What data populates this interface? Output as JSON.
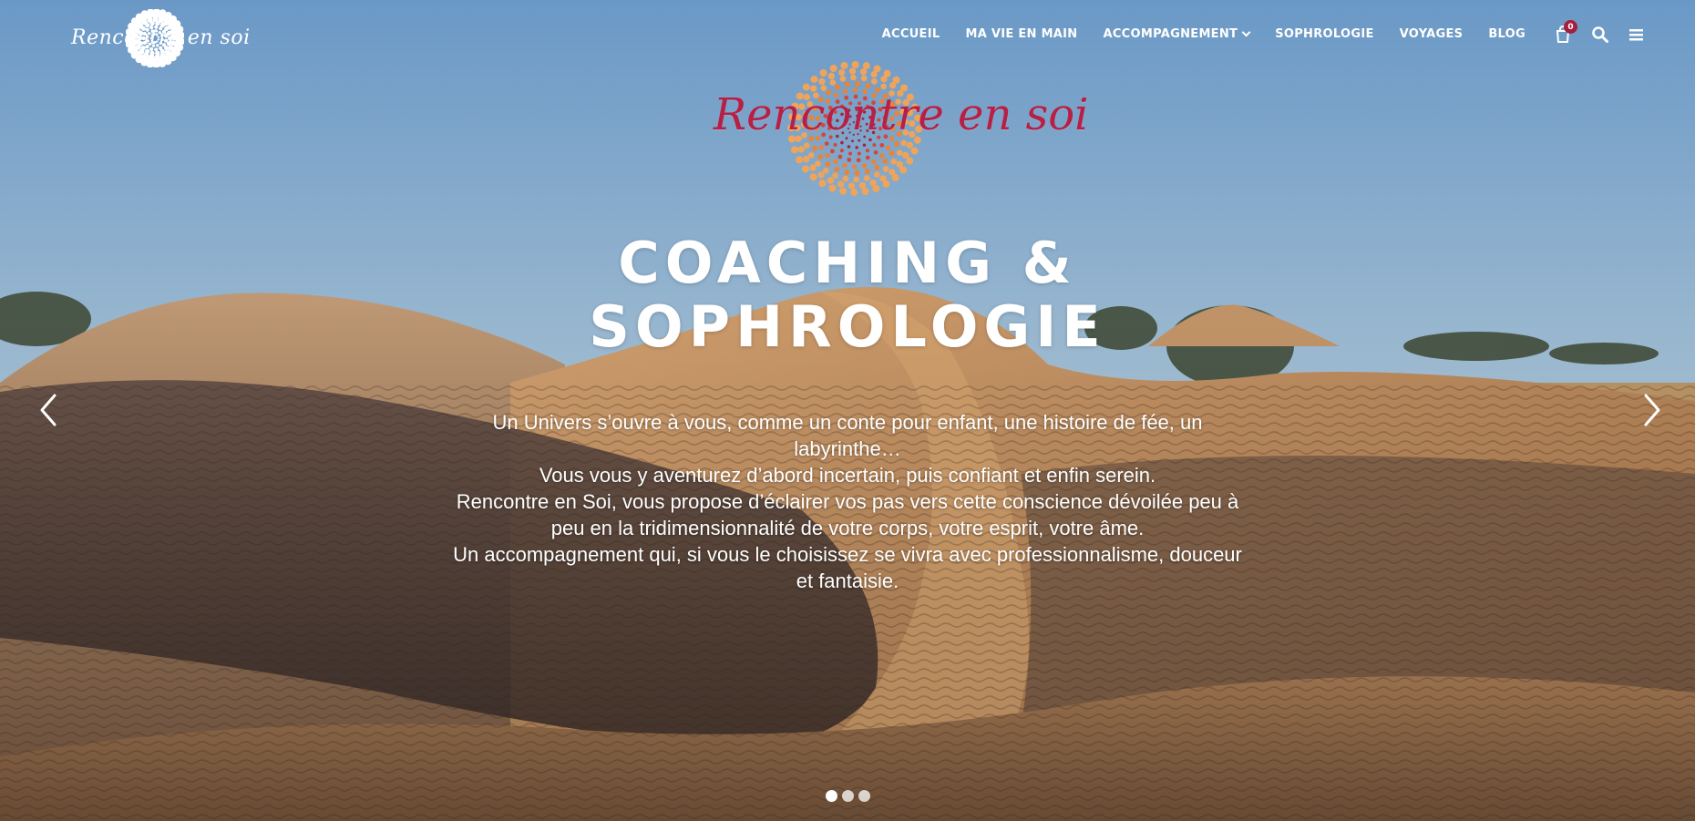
{
  "header": {
    "logo_text": "Rencontre en soi",
    "nav": [
      {
        "label": "ACCUEIL"
      },
      {
        "label": "MA VIE EN MAIN"
      },
      {
        "label": "ACCOMPAGNEMENT"
      },
      {
        "label": "SOPHROLOGIE"
      },
      {
        "label": "VOYAGES"
      },
      {
        "label": "BLOG"
      }
    ],
    "cart_count": "0",
    "icons": [
      "cart-icon",
      "search-icon",
      "menu-icon"
    ]
  },
  "hero": {
    "brand_text": "Rencontre en soi",
    "title_line1": "COACHING &",
    "title_line2": "SOPHROLOGIE",
    "paragraphs": [
      "Un Univers s’ouvre à vous, comme un conte pour enfant, une histoire de fée, un labyrinthe…",
      "Vous vous y aventurez d’abord incertain, puis confiant et enfin serein.",
      "Rencontre en Soi, vous propose d’éclairer vos pas vers cette conscience dévoilée peu à peu en la tridimensionnalité de votre corps, votre esprit, votre âme.",
      "Un accompagnement qui, si vous le choisissez se vivra avec professionnalisme, douceur et fantaisie."
    ],
    "slider": {
      "slide_count": 3,
      "active_slide": 1,
      "prev_icon": "chevron-left-icon",
      "next_icon": "chevron-right-icon"
    }
  },
  "colors": {
    "brand_red": "#b81f45",
    "badge": "#a51e3d",
    "spiral_orange": "#e8843a"
  }
}
